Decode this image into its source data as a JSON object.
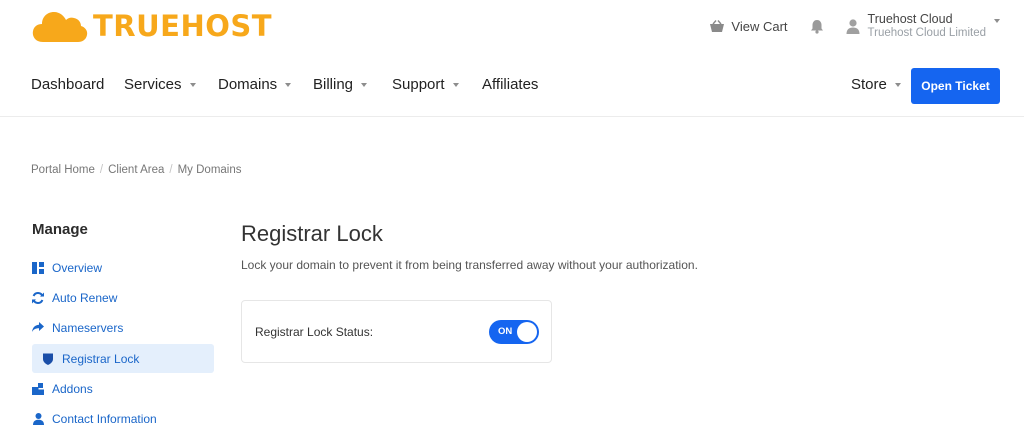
{
  "brand": {
    "name": "TRUEHOST",
    "color": "#f7a81b"
  },
  "header": {
    "cart_label": "View Cart",
    "user_name": "Truehost Cloud",
    "user_company": "Truehost Cloud Limited"
  },
  "nav": {
    "items": [
      {
        "label": "Dashboard",
        "dropdown": false
      },
      {
        "label": "Services",
        "dropdown": true
      },
      {
        "label": "Domains",
        "dropdown": true
      },
      {
        "label": "Billing",
        "dropdown": true
      },
      {
        "label": "Support",
        "dropdown": true
      },
      {
        "label": "Affiliates",
        "dropdown": false
      }
    ],
    "store_label": "Store",
    "open_ticket_label": "Open Ticket",
    "accent": "#1565f0"
  },
  "breadcrumb": [
    "Portal Home",
    "Client Area",
    "My Domains"
  ],
  "sidebar": {
    "title": "Manage",
    "items": [
      {
        "label": "Overview",
        "icon": "dashboard-icon",
        "active": false
      },
      {
        "label": "Auto Renew",
        "icon": "sync-icon",
        "active": false
      },
      {
        "label": "Nameservers",
        "icon": "share-arrow-icon",
        "active": false
      },
      {
        "label": "Registrar Lock",
        "icon": "shield-icon",
        "active": true
      },
      {
        "label": "Addons",
        "icon": "cubes-icon",
        "active": false
      },
      {
        "label": "Contact Information",
        "icon": "user-icon",
        "active": false
      }
    ]
  },
  "main": {
    "title": "Registrar Lock",
    "description": "Lock your domain to prevent it from being transferred away without your authorization.",
    "status_label": "Registrar Lock Status:",
    "toggle_text": "ON",
    "toggle_on": true
  }
}
